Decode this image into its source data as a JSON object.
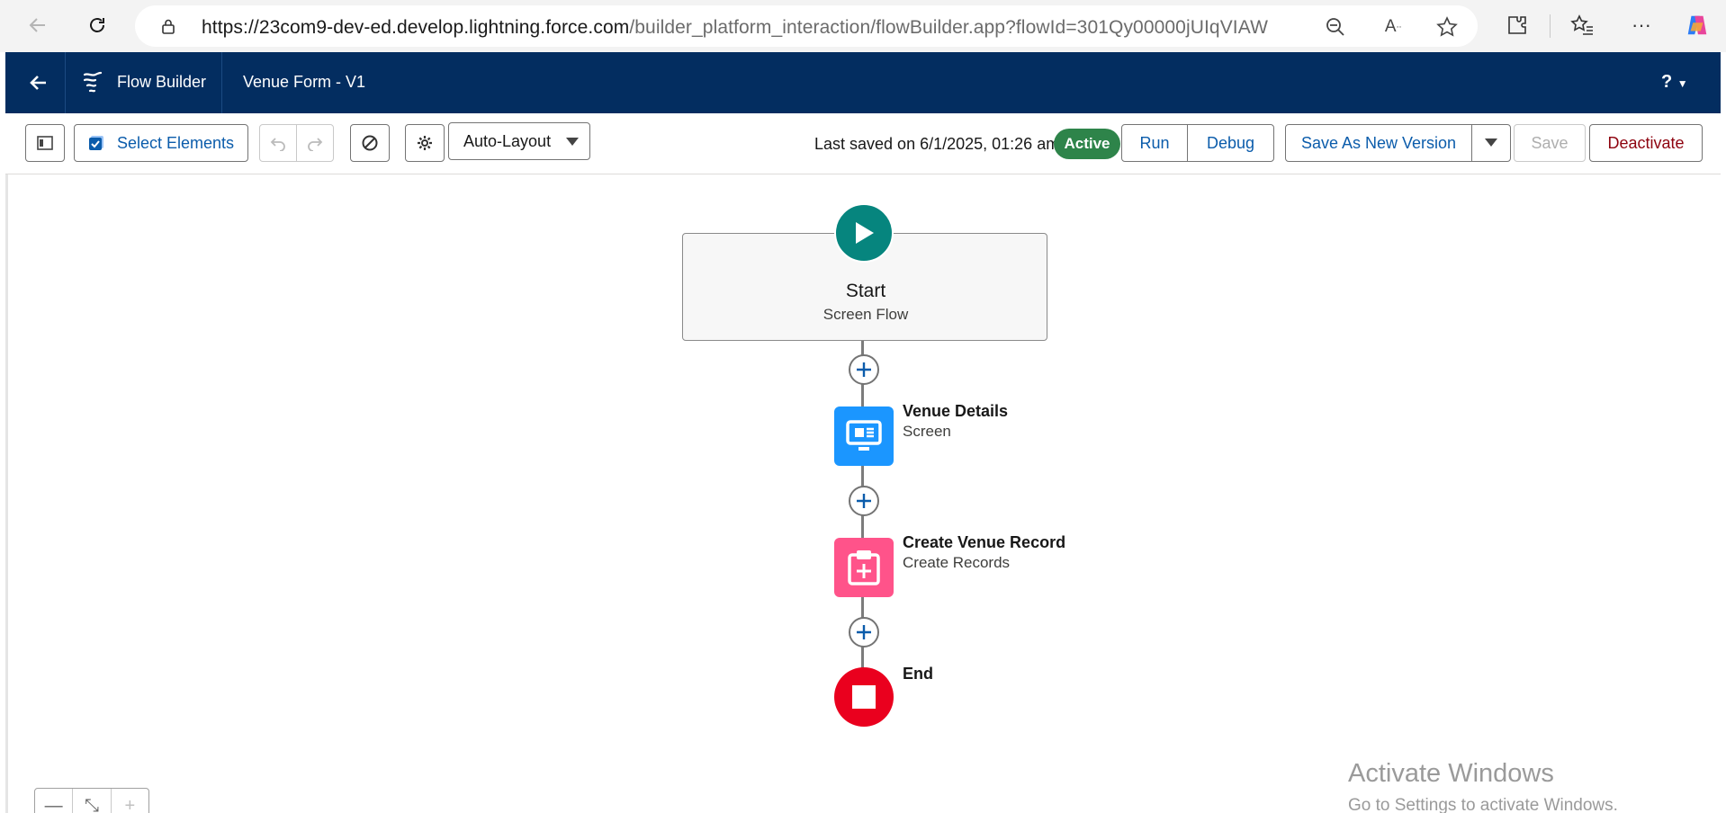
{
  "browser": {
    "url_host": "https://23com9-dev-ed.develop.lightning.force.com",
    "url_path": "/builder_platform_interaction/flowBuilder.app?flowId=301Qy00000jUIqVIAW",
    "icons": [
      "back-icon",
      "refresh-icon",
      "lock-icon",
      "zoom-out-icon",
      "read-aloud-icon",
      "favorite-star-icon",
      "extensions-icon",
      "favorites-list-icon",
      "more-icon",
      "copilot-icon"
    ]
  },
  "header": {
    "app_name": "Flow Builder",
    "flow_name": "Venue Form - V1",
    "help_label": "?"
  },
  "toolbar": {
    "select_elements_label": "Select Elements",
    "layout_label": "Auto-Layout",
    "last_saved": "Last saved on 6/1/2025, 01:26 am",
    "status_badge": "Active",
    "run_label": "Run",
    "debug_label": "Debug",
    "save_new_version_label": "Save As New Version",
    "save_label": "Save",
    "deactivate_label": "Deactivate"
  },
  "flow": {
    "start": {
      "title": "Start",
      "subtitle": "Screen Flow"
    },
    "nodes": [
      {
        "title": "Venue Details",
        "subtitle": "Screen",
        "color": "#1b96ff",
        "icon": "screen-icon"
      },
      {
        "title": "Create Venue Record",
        "subtitle": "Create Records",
        "color": "#ff538a",
        "icon": "create-records-icon"
      }
    ],
    "end": {
      "title": "End",
      "color": "#ea001e"
    }
  },
  "zoom": {
    "minus": "—",
    "fit": "⤡",
    "plus": "+"
  },
  "watermark": {
    "line1": "Activate Windows",
    "line2": "Go to Settings to activate Windows."
  },
  "colors": {
    "header_bg": "#032d60",
    "accent_blue": "#0b5cab",
    "active_green": "#2e844a",
    "start_teal": "#06857e",
    "deactivate_red": "#8e030f"
  }
}
